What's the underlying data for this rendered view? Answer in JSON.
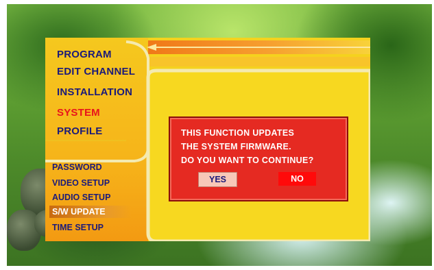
{
  "menu": {
    "items": [
      {
        "label": "PROGRAM",
        "active": false
      },
      {
        "label": "EDIT CHANNEL",
        "active": false
      },
      {
        "label": "INSTALLATION",
        "active": false
      },
      {
        "label": "SYSTEM",
        "active": true
      },
      {
        "label": "PROFILE",
        "active": false
      }
    ]
  },
  "submenu": {
    "items": [
      {
        "label": "PASSWORD",
        "selected": false
      },
      {
        "label": "VIDEO SETUP",
        "selected": false
      },
      {
        "label": "AUDIO SETUP",
        "selected": false
      },
      {
        "label": "S/W UPDATE",
        "selected": true
      },
      {
        "label": "TIME SETUP",
        "selected": false
      }
    ]
  },
  "dialog": {
    "lines": [
      "THIS FUNCTION UPDATES",
      "THE SYSTEM FIRMWARE.",
      "DO YOU WANT TO CONTINUE?"
    ],
    "yes_label": "YES",
    "no_label": "NO",
    "focused": "NO"
  },
  "colors": {
    "panel": "#f5d21e",
    "menu_text": "#1b1a7a",
    "active_text": "#e8141c",
    "dialog_bg": "#e52a22"
  }
}
